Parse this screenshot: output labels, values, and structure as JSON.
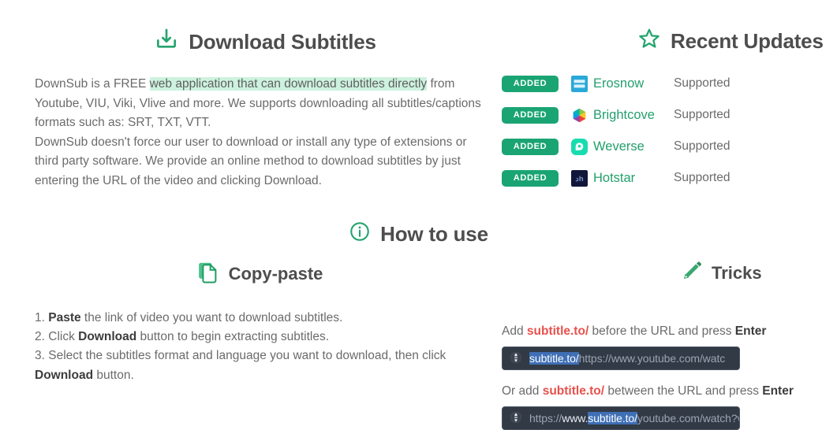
{
  "download": {
    "icon": "download-icon",
    "title": "Download Subtitles",
    "paragraph1_pre": "DownSub is a FREE ",
    "paragraph1_selected": "web application that can download subtitles directly",
    "paragraph1_post": " from Youtube, VIU, Viki, Vlive and more. We supports downloading all subtitles/captions formats such as: SRT, TXT, VTT.",
    "paragraph2": "DownSub doesn't force our user to download or install any type of extensions or third party software. We provide an online method to download subtitles by just entering the URL of the video and clicking Download."
  },
  "updates": {
    "icon": "star-icon",
    "title": "Recent Updates",
    "rows": [
      {
        "badge": "ADDED",
        "logo": "erosnow-logo",
        "name": "Erosnow",
        "status": "Supported"
      },
      {
        "badge": "ADDED",
        "logo": "brightcove-logo",
        "name": "Brightcove",
        "status": "Supported"
      },
      {
        "badge": "ADDED",
        "logo": "weverse-logo",
        "name": "Weverse",
        "status": "Supported"
      },
      {
        "badge": "ADDED",
        "logo": "hotstar-logo",
        "name": "Hotstar",
        "status": "Supported"
      }
    ]
  },
  "howto": {
    "icon": "info-circle-icon",
    "title": "How to use"
  },
  "copypaste": {
    "icon": "copy-icon",
    "title": "Copy-paste",
    "steps": [
      {
        "num": "1.",
        "bold": "Paste",
        "rest": " the link of video you want to download subtitles.",
        "pre": ""
      },
      {
        "num": "2.",
        "bold": "Download",
        "rest": " button to begin extracting subtitles.",
        "pre": " Click "
      },
      {
        "num": "3.",
        "bold": "",
        "rest": "",
        "pre": " Select the subtitles format and language you want to download, then click "
      }
    ],
    "step3_bold": "Download",
    "step3_tail": " button."
  },
  "tricks": {
    "icon": "pencil-icon",
    "title": "Tricks",
    "line1_pre": "Add ",
    "line1_brand": "subtitle.to/",
    "line1_mid": " before the URL and press ",
    "line1_key": "Enter",
    "urlbar1": {
      "icon": "globe-icon",
      "highlighted": "subtitle.to/",
      "rest": "https://www.youtube.com/watc"
    },
    "line2_pre": "Or add ",
    "line2_brand": "subtitle.to/",
    "line2_mid": " between the URL and press ",
    "line2_key": "Enter",
    "urlbar2": {
      "icon": "globe-icon",
      "prefix_dim": "https://",
      "prefix_strong": "www.",
      "highlighted": "subtitle.to/",
      "rest": "youtube.com/watch?v"
    }
  },
  "colors": {
    "accent_green": "#23a06c",
    "badge_green": "#1aa474",
    "selection_green": "#cdf2df",
    "brand_red": "#e8514c",
    "urlbar_bg": "#323a45",
    "url_highlight": "#3f6fb5",
    "heading_gray": "#4d4d4d",
    "body_gray": "#6b6b6b"
  }
}
